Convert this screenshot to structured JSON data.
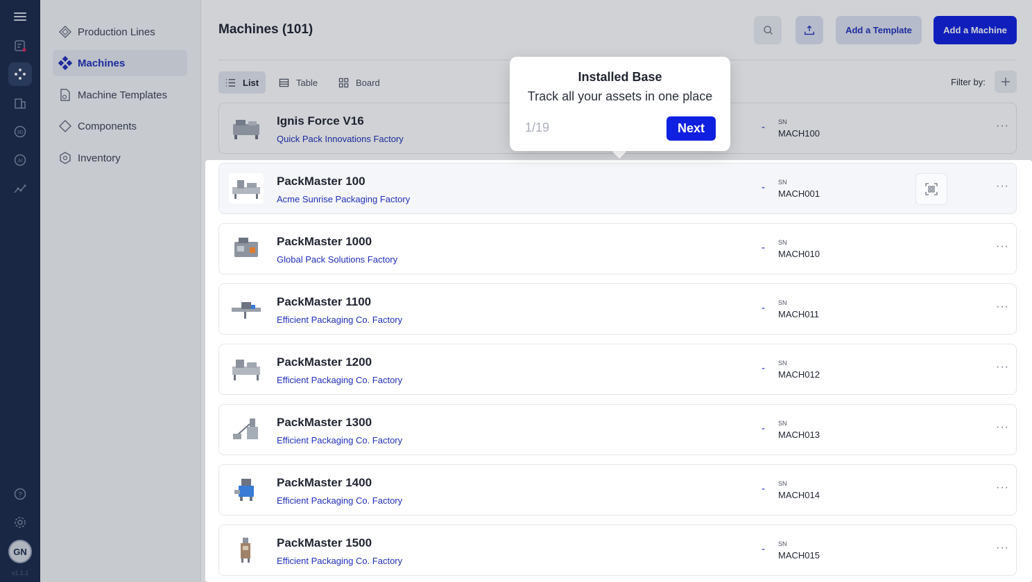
{
  "rail": {
    "items": [
      {
        "icon": "hamburger-menu-icon"
      },
      {
        "icon": "tickets-icon"
      },
      {
        "icon": "installed-base-icon",
        "active": true
      },
      {
        "icon": "building-icon"
      },
      {
        "icon": "3d-icon"
      },
      {
        "icon": "ai-icon"
      },
      {
        "icon": "analytics-icon"
      },
      {
        "icon": "help-icon"
      },
      {
        "icon": "gear-icon"
      }
    ],
    "avatar": "GN",
    "version": "v1.1.1"
  },
  "subnav": {
    "items": [
      {
        "label": "Production Lines",
        "icon": "production-lines-icon",
        "active": false
      },
      {
        "label": "Machines",
        "icon": "machines-icon",
        "active": true
      },
      {
        "label": "Machine Templates",
        "icon": "machine-templates-icon",
        "active": false
      },
      {
        "label": "Components",
        "icon": "components-icon",
        "active": false
      },
      {
        "label": "Inventory",
        "icon": "inventory-icon",
        "active": false
      }
    ]
  },
  "header": {
    "title": "Machines (101)",
    "add_template_label": "Add a Template",
    "add_machine_label": "Add a Machine"
  },
  "views": {
    "list": "List",
    "table": "Table",
    "board": "Board",
    "filter_label": "Filter by:"
  },
  "rows": [
    {
      "name": "Ignis Force V16",
      "factory": "Quick Pack Innovations Factory",
      "dash": "-",
      "sn_label": "SN",
      "sn": "MACH100"
    },
    {
      "name": "PackMaster 100",
      "factory": "Acme Sunrise Packaging Factory",
      "dash": "-",
      "sn_label": "SN",
      "sn": "MACH001"
    },
    {
      "name": "PackMaster 1000",
      "factory": "Global Pack Solutions Factory",
      "dash": "-",
      "sn_label": "SN",
      "sn": "MACH010"
    },
    {
      "name": "PackMaster 1100",
      "factory": "Efficient Packaging Co. Factory",
      "dash": "-",
      "sn_label": "SN",
      "sn": "MACH011"
    },
    {
      "name": "PackMaster 1200",
      "factory": "Efficient Packaging Co. Factory",
      "dash": "-",
      "sn_label": "SN",
      "sn": "MACH012"
    },
    {
      "name": "PackMaster 1300",
      "factory": "Efficient Packaging Co. Factory",
      "dash": "-",
      "sn_label": "SN",
      "sn": "MACH013"
    },
    {
      "name": "PackMaster 1400",
      "factory": "Efficient Packaging Co. Factory",
      "dash": "-",
      "sn_label": "SN",
      "sn": "MACH014"
    },
    {
      "name": "PackMaster 1500",
      "factory": "Efficient Packaging Co. Factory",
      "dash": "-",
      "sn_label": "SN",
      "sn": "MACH015"
    }
  ],
  "row_more": "···",
  "popover": {
    "title": "Installed Base",
    "text": "Track all your assets in one place",
    "step": "1/19",
    "next_label": "Next"
  },
  "colors": {
    "rail_bg": "#1b2a4a",
    "accent": "#1020e0",
    "link": "#1f2fb8"
  }
}
